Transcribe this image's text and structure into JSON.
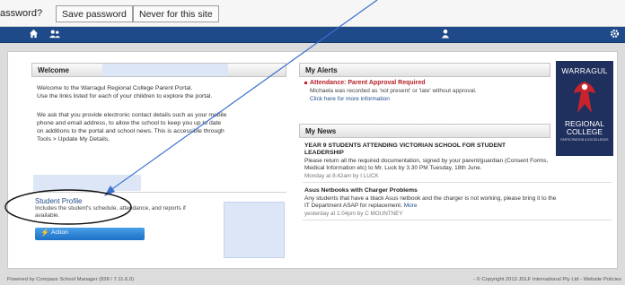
{
  "browser_bar": {
    "question": "assword?",
    "save_label": "Save password",
    "never_label": "Never for this site"
  },
  "nav": {
    "home_icon": "home-icon",
    "users_icon": "users-icon",
    "user_icon": "user-icon",
    "settings_icon": "gear-icon"
  },
  "welcome": {
    "heading": "Welcome",
    "para1_line1": "Welcome to the Warragul Regional College Parent Portal.",
    "para1_line2": "Use the links listed for each of your children to explore the portal.",
    "para2_line1": "We ask that you provide electronic contact details such as your mobile",
    "para2_line2": "phone and email address, to allow the school to keep you up to date",
    "para2_line3": "on additions to the portal and school news. This is accessible through",
    "para2_line4": "Tools > Update My Details."
  },
  "student_profile": {
    "title": "Student Profile",
    "desc_line1": "Includes the student's schedule, attendance, and reports if",
    "desc_line2": "available.",
    "action_label": "Action"
  },
  "alerts": {
    "heading": "My Alerts",
    "title": "Attendance: Parent Approval Required",
    "body": "Michaela was recorded as 'not present' or 'late' without approval.",
    "link": "Click here for more information"
  },
  "news": {
    "heading": "My News",
    "items": [
      {
        "title_line1": "YEAR 9 STUDENTS ATTENDING VICTORIAN SCHOOL FOR STUDENT",
        "title_line2": "LEADERSHIP",
        "body_line1": "Please return all the required documentation, signed by your parent/guardian (Consent Forms,",
        "body_line2": "Medical Information etc) to Mr. Luck by 3.30 PM Tuesday, 18th June.",
        "more": "",
        "meta": "Monday at 8:42am by I LUCK"
      },
      {
        "title_line1": "Asus Netbooks with Charger Problems",
        "body_line1": "Any students that have a black Asus netbook and the charger is not working, please bring it to the",
        "body_line2": "IT Department ASAP for replacement.",
        "more": "More",
        "meta": "yesterday at 1:04pm by C MOUNTNEY"
      }
    ]
  },
  "logo": {
    "top": "WARRAGUL",
    "mid": "REGIONAL COLLEGE",
    "tag": "PARTICIPATION & EXCELLENCE"
  },
  "footer": {
    "left": "Powered by Compass School Manager (828 / 7.11.6.0)",
    "right": "- © Copyright 2013 JDLF International Pty Ltd - Website Policies"
  },
  "colors": {
    "nav": "#1f4a8a",
    "accent": "#1f4a8a",
    "alert": "#b5202a",
    "logo_bg": "#20305e"
  }
}
